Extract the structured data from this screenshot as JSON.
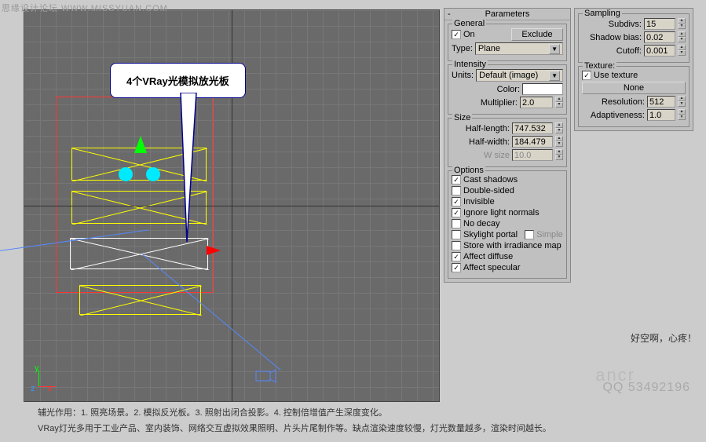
{
  "watermark_top": "思缘设计论坛  WWW.MISSYUAN.COM",
  "callout_text": "4个VRay光模拟放光板",
  "side_comment": "好空啊，心疼！",
  "watermark_an": "ancr",
  "watermark_qq": "QQ  53492196",
  "parameters_title": "Parameters",
  "general": {
    "label": "General",
    "on_label": "On",
    "on_checked": true,
    "exclude_btn": "Exclude",
    "type_label": "Type:",
    "type_value": "Plane"
  },
  "intensity": {
    "label": "Intensity",
    "units_label": "Units:",
    "units_value": "Default (image)",
    "color_label": "Color:",
    "multiplier_label": "Multiplier:",
    "multiplier_value": "2.0"
  },
  "size": {
    "label": "Size",
    "half_length_label": "Half-length:",
    "half_length_value": "747.532",
    "half_width_label": "Half-width:",
    "half_width_value": "184.479",
    "w_size_label": "W size",
    "w_size_value": "10.0"
  },
  "options": {
    "label": "Options",
    "cast_shadows": "Cast shadows",
    "cast_shadows_checked": true,
    "double_sided": "Double-sided",
    "double_sided_checked": false,
    "invisible": "Invisible",
    "invisible_checked": true,
    "ignore_normals": "Ignore light normals",
    "ignore_normals_checked": true,
    "no_decay": "No decay",
    "no_decay_checked": false,
    "skylight_portal": "Skylight portal",
    "skylight_portal_checked": false,
    "simple": "Simple",
    "simple_checked": false,
    "store_irradiance": "Store with irradiance map",
    "store_irradiance_checked": false,
    "affect_diffuse": "Affect diffuse",
    "affect_diffuse_checked": true,
    "affect_specular": "Affect specular",
    "affect_specular_checked": true
  },
  "sampling": {
    "label": "Sampling",
    "subdivs_label": "Subdivs:",
    "subdivs_value": "15",
    "shadow_bias_label": "Shadow bias:",
    "shadow_bias_value": "0.02",
    "cutoff_label": "Cutoff:",
    "cutoff_value": "0.001"
  },
  "texture": {
    "label": "Texture:",
    "use_texture": "Use texture",
    "use_texture_checked": true,
    "none_btn": "None",
    "resolution_label": "Resolution:",
    "resolution_value": "512",
    "adaptiveness_label": "Adaptiveness:",
    "adaptiveness_value": "1.0"
  },
  "caption": {
    "line1": "辅光作用：1. 照亮场景。2. 模拟反光板。3. 照射出闭合投影。4. 控制倍增值产生深度变化。",
    "line2": "VRay灯光多用于工业产品、室内装饰、网络交互虚拟效果照明、片头片尾制作等。缺点渲染速度较慢，灯光数量越多，渲染时间越长。"
  }
}
